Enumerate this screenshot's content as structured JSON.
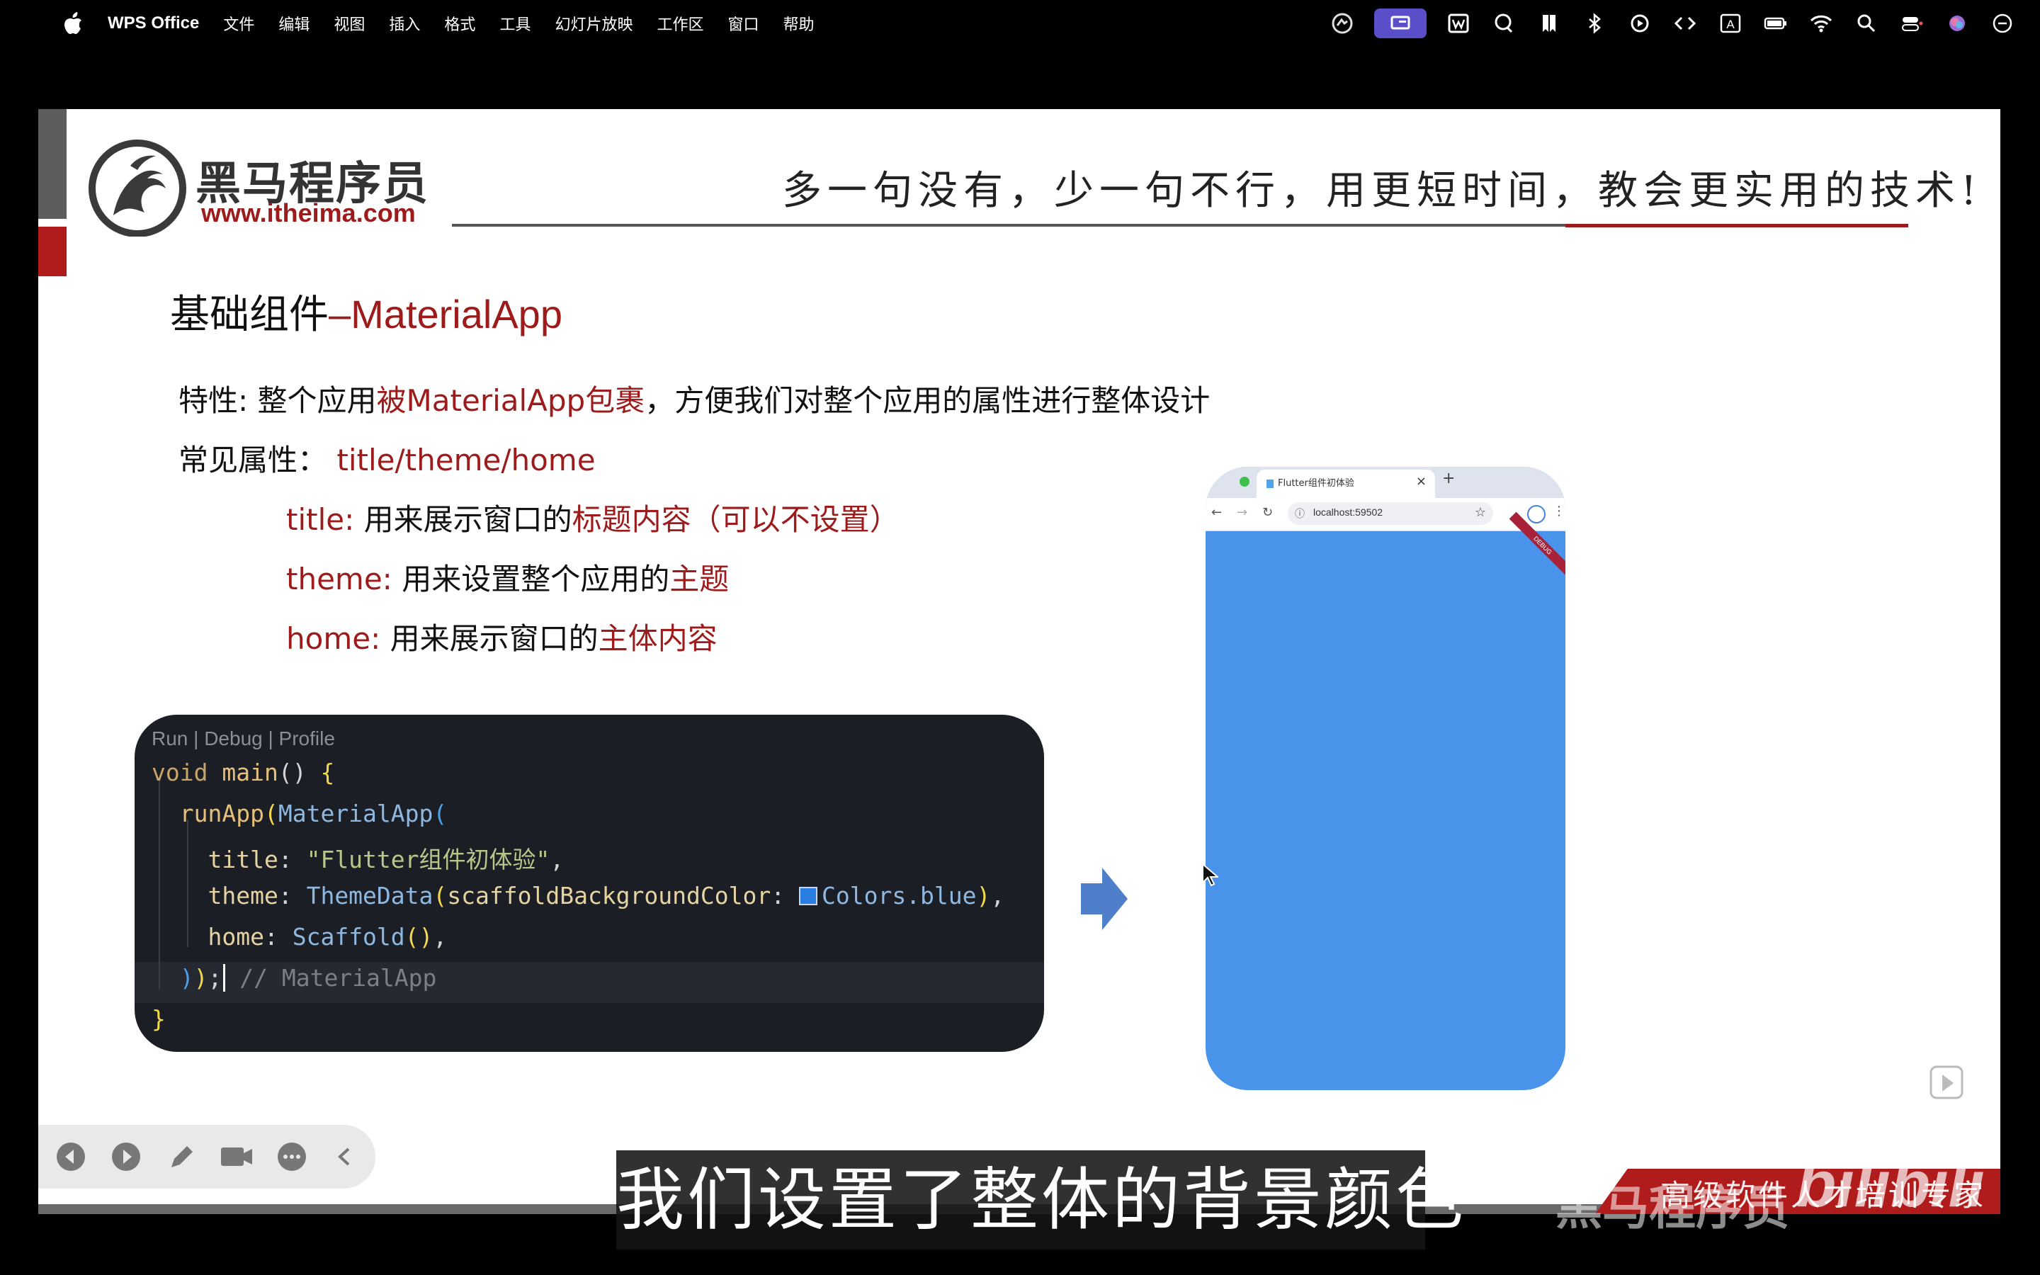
{
  "menubar": {
    "app_name": "WPS Office",
    "items": [
      "文件",
      "编辑",
      "视图",
      "插入",
      "格式",
      "工具",
      "幻灯片放映",
      "工作区",
      "窗口",
      "帮助"
    ],
    "status_icons": [
      "vpn-icon",
      "screen-share-icon",
      "wps-icon",
      "chat-icon",
      "bookmark-icon",
      "bluetooth-icon",
      "play-circle-icon",
      "code-icon",
      "input-method-icon",
      "battery-icon",
      "wifi-icon",
      "search-icon",
      "control-center-icon",
      "siri-icon",
      "minus-circle-icon"
    ],
    "input_method_label": "A"
  },
  "slide": {
    "logo_text": "黑马程序员",
    "logo_url": "www.itheima.com",
    "slogan": "多一句没有，少一句不行，用更短时间，教会更实用的技术!",
    "title_prefix": "基础组件",
    "title_suffix": "–MaterialApp",
    "feature_label": "特性",
    "feature_text_a": ": 整个应用",
    "feature_highlight": "被MaterialApp包裹",
    "feature_text_b": "，方便我们对整个应用的属性进行整体设计",
    "common_props_label": "常见属性：",
    "common_props_value": "title/theme/home",
    "props": [
      {
        "name": "title: ",
        "desc": "用来展示窗口的",
        "highlight": "标题内容（可以不设置）"
      },
      {
        "name": "theme: ",
        "desc": "用来设置整个应用的",
        "highlight": "主题"
      },
      {
        "name": "home: ",
        "desc": "用来展示窗口的",
        "highlight": "主体内容"
      }
    ],
    "brand_footer": "高级软件人才培训专家"
  },
  "code": {
    "codelens": "Run | Debug | Profile",
    "void": "void",
    "main": "main",
    "runApp": "runApp",
    "materialApp": "MaterialApp",
    "title_key": "title",
    "title_value": "\"Flutter组件初体验\"",
    "theme_key": "theme",
    "theme_data": "ThemeData",
    "scaffold_param": "scaffoldBackgroundColor",
    "colors_blue": "Colors.blue",
    "home_key": "home",
    "scaffold": "Scaffold",
    "comment": "// MaterialApp"
  },
  "browser": {
    "tab_title": "Flutter组件初体验",
    "url": "localhost:59502",
    "debug_label": "DEBUG",
    "background_color": "#4a93ea"
  },
  "player": {
    "subtitle": "我们设置了整体的背景颜色",
    "watermark_cn": "黑马程序员",
    "watermark_logo": "bilibili",
    "toolbar_icons": [
      "prev-icon",
      "next-icon",
      "pen-icon",
      "camera-icon",
      "more-icon",
      "collapse-icon"
    ]
  },
  "colors": {
    "accent_red": "#9d1b1b",
    "code_bg": "#1c1e26",
    "menubar_bg": "#000000"
  }
}
